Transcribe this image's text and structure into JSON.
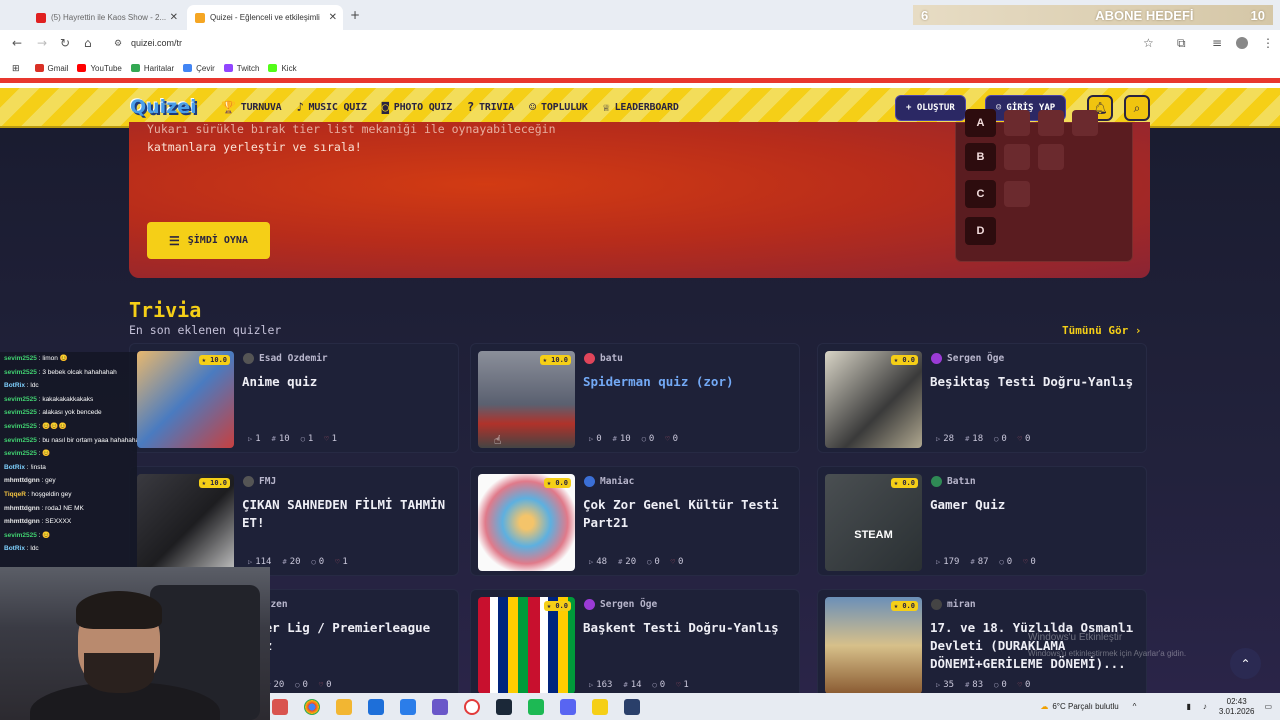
{
  "browser": {
    "tabs": [
      {
        "label": "(5) Hayrettin ile Kaos Show - 2...",
        "fav": "#e02020"
      },
      {
        "label": "Quizei - Eğlenceli ve etkileşimli",
        "fav": "#f5a623"
      }
    ],
    "new_tab": "+",
    "url": "quizei.com/tr",
    "bookmarks": [
      {
        "label": "Gmail",
        "color": "#d93025"
      },
      {
        "label": "YouTube",
        "color": "#ff0000"
      },
      {
        "label": "Haritalar",
        "color": "#34a853"
      },
      {
        "label": "Çevir",
        "color": "#4285f4"
      },
      {
        "label": "Twitch",
        "color": "#9146ff"
      },
      {
        "label": "Kick",
        "color": "#53fc18"
      }
    ]
  },
  "overlay": {
    "abone_left": "6",
    "abone_title": "ABONE HEDEFİ",
    "abone_right": "10"
  },
  "site": {
    "logo": "Quizei",
    "nav": [
      {
        "label": "TURNUVA",
        "icon": "trophy-icon",
        "glyph": "🏆"
      },
      {
        "label": "MUSIC QUIZ",
        "icon": "music-icon",
        "glyph": "♪"
      },
      {
        "label": "PHOTO QUIZ",
        "icon": "camera-icon",
        "glyph": "◙"
      },
      {
        "label": "TRIVIA",
        "icon": "question-icon",
        "glyph": "?"
      },
      {
        "label": "TOPLULUK",
        "icon": "users-icon",
        "glyph": "☺"
      },
      {
        "label": "LEADERBOARD",
        "icon": "trophy-icon",
        "glyph": "♕"
      }
    ],
    "create_label": "+ OLUŞTUR",
    "login_label": "GİRİŞ YAP"
  },
  "hero": {
    "text_line1": "Yukarı sürükle bırak tier list mekaniği ile oynayabileceğin",
    "text_line2": "katmanlara yerleştir ve sırala!",
    "play_label": "ŞİMDİ OYNA",
    "tiers": [
      "A",
      "B",
      "C",
      "D"
    ]
  },
  "trivia": {
    "title": "Trivia",
    "subtitle": "En son eklenen quizler",
    "see_all": "Tümünü Gör ›",
    "cards": [
      {
        "author": "Esad Ozdemir",
        "title": "Anime quiz",
        "rating": "10.0",
        "plays": "1",
        "questions": "10",
        "comments": "1",
        "likes": "1",
        "avatar_color": "#555",
        "thumb": "anime"
      },
      {
        "author": "batu",
        "title": "Spiderman quiz (zor)",
        "rating": "10.0",
        "plays": "0",
        "questions": "10",
        "comments": "0",
        "likes": "0",
        "avatar_color": "#e0455a",
        "thumb": "spider",
        "blue": true
      },
      {
        "author": "Sergen Öge",
        "title": "Beşiktaş Testi Doğru-Yanlış",
        "rating": "0.0",
        "plays": "28",
        "questions": "18",
        "comments": "0",
        "likes": "0",
        "avatar_color": "#9b3bd6",
        "thumb": "bjk"
      },
      {
        "author": "FMJ",
        "title": "ÇIKAN SAHNEDEN FİLMİ TAHMİN ET!",
        "rating": "10.0",
        "plays": "114",
        "questions": "20",
        "comments": "0",
        "likes": "1",
        "avatar_color": "#555",
        "thumb": "film"
      },
      {
        "author": "Maniac",
        "title": "Çok Zor Genel Kültür Testi Part21",
        "rating": "0.0",
        "plays": "48",
        "questions": "20",
        "comments": "0",
        "likes": "0",
        "avatar_color": "#3b6fd6",
        "thumb": "brain"
      },
      {
        "author": "Batın",
        "title": "Gamer Quiz",
        "rating": "0.0",
        "plays": "179",
        "questions": "87",
        "comments": "0",
        "likes": "0",
        "avatar_color": "#2f8a55",
        "thumb": "steam",
        "thumb_text": "STEAM"
      },
      {
        "author": "Sezen",
        "title": "Süper Lig / Premierleague Quiz",
        "rating": "",
        "plays": "",
        "questions": "20",
        "comments": "0",
        "likes": "0",
        "avatar_color": "#555",
        "thumb": "none"
      },
      {
        "author": "Sergen Öge",
        "title": "Başkent Testi Doğru-Yanlış",
        "rating": "0.0",
        "plays": "163",
        "questions": "14",
        "comments": "0",
        "likes": "1",
        "avatar_color": "#9b3bd6",
        "thumb": "flags"
      },
      {
        "author": "miran",
        "title": "17. ve 18. Yüzlılda Osmanlı Devleti (DURAKLAMA DÖNEMİ+GERİLEME DÖNEMİ)...",
        "rating": "0.0",
        "plays": "35",
        "questions": "83",
        "comments": "0",
        "likes": "0",
        "avatar_color": "#444",
        "thumb": "ottoman"
      }
    ]
  },
  "watermark": {
    "line1": "Windows'u Etkinleştir",
    "line2": "Windows'u etkinleştirmek için Ayarlar'a gidin."
  },
  "chat": [
    {
      "user": "sevim2525",
      "msg": "limon 😊",
      "color": "#40d070"
    },
    {
      "user": "sevim2525",
      "msg": "3 bebek olcak hahahahah",
      "color": "#40d070"
    },
    {
      "user": "BotRix",
      "msg": "ldc",
      "color": "#7fd1ff"
    },
    {
      "user": "sevim2525",
      "msg": "kakakakakkakaks",
      "color": "#40d070"
    },
    {
      "user": "sevim2525",
      "msg": "alakası yok bencede",
      "color": "#40d070"
    },
    {
      "user": "sevim2525",
      "msg": "😊😊😊",
      "color": "#40d070"
    },
    {
      "user": "sevim2525",
      "msg": "bu nasıl bir ortam yaaa hahahahah",
      "color": "#40d070"
    },
    {
      "user": "sevim2525",
      "msg": "😊",
      "color": "#40d070"
    },
    {
      "user": "BotRix",
      "msg": "!insta",
      "color": "#7fd1ff"
    },
    {
      "user": "mhmttdgnn",
      "msg": "gey",
      "color": "#e8e8e8"
    },
    {
      "user": "TiqqeR",
      "msg": "hoşgeldin gey",
      "color": "#f5c542"
    },
    {
      "user": "mhmttdgnn",
      "msg": "rodaJ NE MK",
      "color": "#e8e8e8"
    },
    {
      "user": "mhmttdgnn",
      "msg": "SEXXXX",
      "color": "#e8e8e8"
    },
    {
      "user": "sevim2525",
      "msg": "😊",
      "color": "#40d070"
    },
    {
      "user": "BotRix",
      "msg": "ldc",
      "color": "#7fd1ff"
    }
  ],
  "taskbar": {
    "weather": "6°C  Parçalı bulutlu",
    "time": "02:43",
    "date": "3.01.2026"
  }
}
